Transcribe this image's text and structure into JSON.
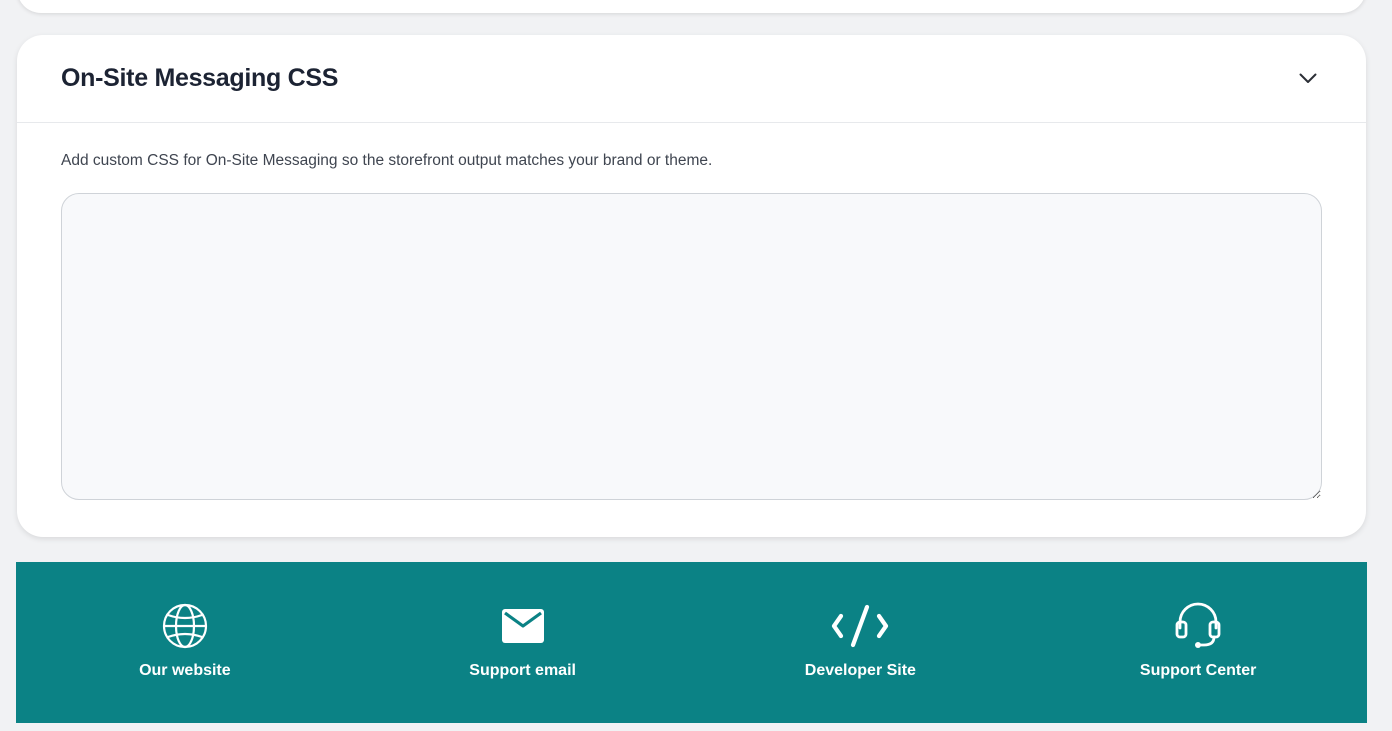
{
  "section": {
    "title": "On-Site Messaging CSS",
    "description": "Add custom CSS for On-Site Messaging so the storefront output matches your brand or theme.",
    "css_value": "",
    "collapse_icon": "chevron-down-icon"
  },
  "footer": {
    "background": "#0b8285",
    "links": [
      {
        "label": "Our website",
        "icon": "globe-icon"
      },
      {
        "label": "Support email",
        "icon": "envelope-icon"
      },
      {
        "label": "Developer Site",
        "icon": "code-icon"
      },
      {
        "label": "Support Center",
        "icon": "headset-icon"
      }
    ]
  }
}
